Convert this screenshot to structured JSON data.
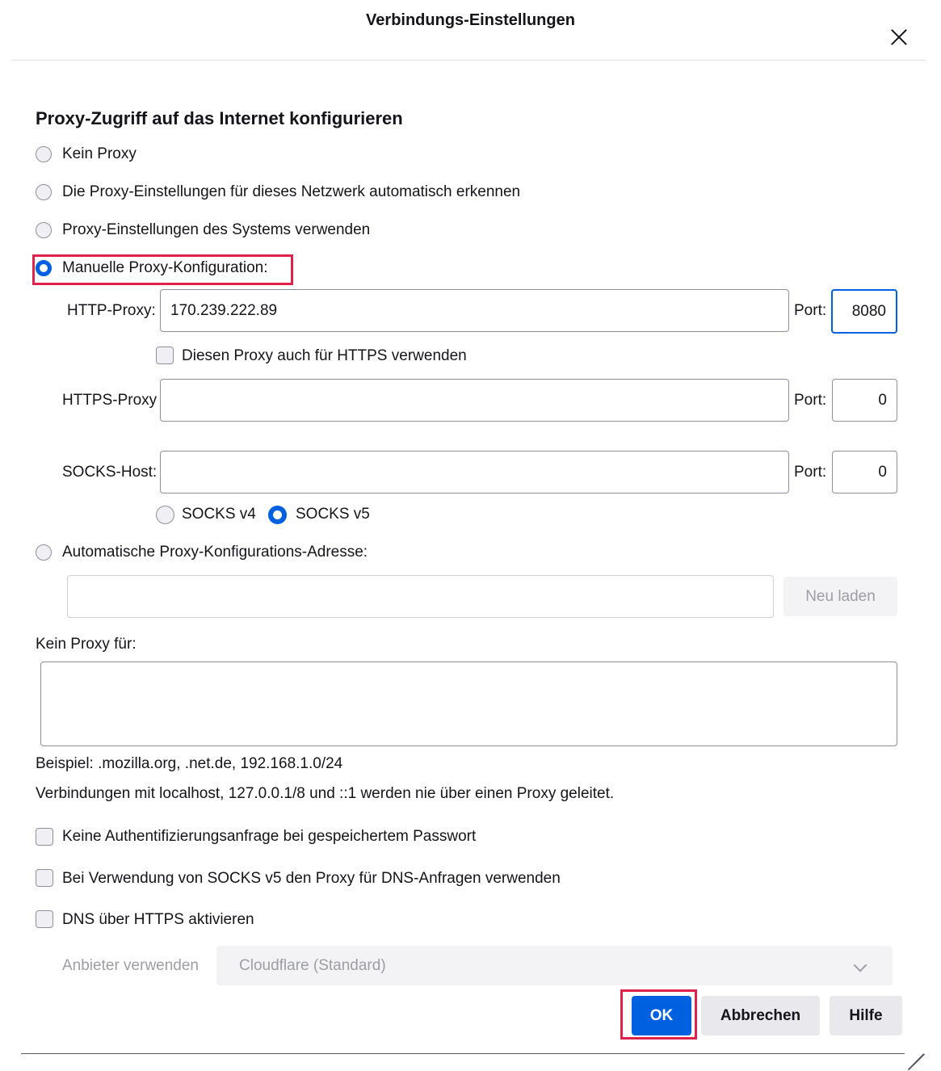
{
  "window": {
    "title": "Verbindungs-Einstellungen"
  },
  "heading": "Proxy-Zugriff auf das Internet konfigurieren",
  "proxy_modes": {
    "no_proxy": "Kein Proxy",
    "auto_detect": "Die Proxy-Einstellungen für dieses Netzwerk automatisch erkennen",
    "system": "Proxy-Einstellungen des Systems verwenden",
    "manual": "Manuelle Proxy-Konfiguration:",
    "pac": "Automatische Proxy-Konfigurations-Adresse:",
    "selected": "manual"
  },
  "manual": {
    "http_label": "HTTP-Proxy:",
    "http_value": "170.239.222.89",
    "http_port_label": "Port:",
    "http_port": "8080",
    "also_https_label": "Diesen Proxy auch für HTTPS verwenden",
    "also_https_checked": false,
    "https_label": "HTTPS-Proxy",
    "https_value": "",
    "https_port_label": "Port:",
    "https_port": "0",
    "socks_label": "SOCKS-Host:",
    "socks_value": "",
    "socks_port_label": "Port:",
    "socks_port": "0",
    "socks_v4_label": "SOCKS v4",
    "socks_v5_label": "SOCKS v5",
    "socks_version_selected": "v5"
  },
  "pac": {
    "url_value": "",
    "reload_label": "Neu laden"
  },
  "no_proxy_for": {
    "label": "Kein Proxy für:",
    "value": "",
    "example": "Beispiel: .mozilla.org, .net.de, 192.168.1.0/24",
    "note": "Verbindungen mit localhost, 127.0.0.1/8 und ::1 werden nie über einen Proxy geleitet."
  },
  "options": {
    "no_auth_prompt": "Keine Authentifizierungsanfrage bei gespeichertem Passwort",
    "socks_dns": "Bei Verwendung von SOCKS v5 den Proxy für DNS-Anfragen verwenden",
    "doh": "DNS über HTTPS aktivieren",
    "provider_label": "Anbieter verwenden",
    "provider_value": "Cloudflare (Standard)"
  },
  "buttons": {
    "ok": "OK",
    "cancel": "Abbrechen",
    "help": "Hilfe"
  },
  "colors": {
    "accent": "#0061e0",
    "highlight": "#e0224a"
  }
}
